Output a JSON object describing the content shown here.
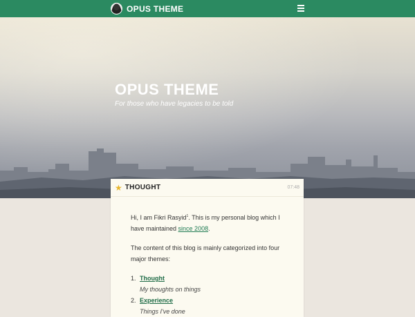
{
  "header": {
    "site_name": "OPUS THEME",
    "avatar_icon": "avatar-icon",
    "menu_icon": "hamburger-menu-icon",
    "bar_color": "#2b8a61"
  },
  "hero": {
    "title": "OPUS THEME",
    "subtitle": "For those who have legacies to be told"
  },
  "post": {
    "category_icon": "star-icon",
    "category": "THOUGHT",
    "time": "07:48",
    "intro_before": "Hi, I am Fikri Rasyid",
    "intro_sup": "1",
    "intro_after": ". This is my personal blog which I have maintained ",
    "intro_link": "since 2008",
    "intro_end": ".",
    "content_text": "The content of this blog is mainly categorized into four major themes:",
    "themes": [
      {
        "num": "1.",
        "title": "Thought",
        "desc": "My thoughts on things"
      },
      {
        "num": "2.",
        "title": "Experience",
        "desc": "Things I've done"
      }
    ],
    "link_color": "#1e7a52"
  }
}
